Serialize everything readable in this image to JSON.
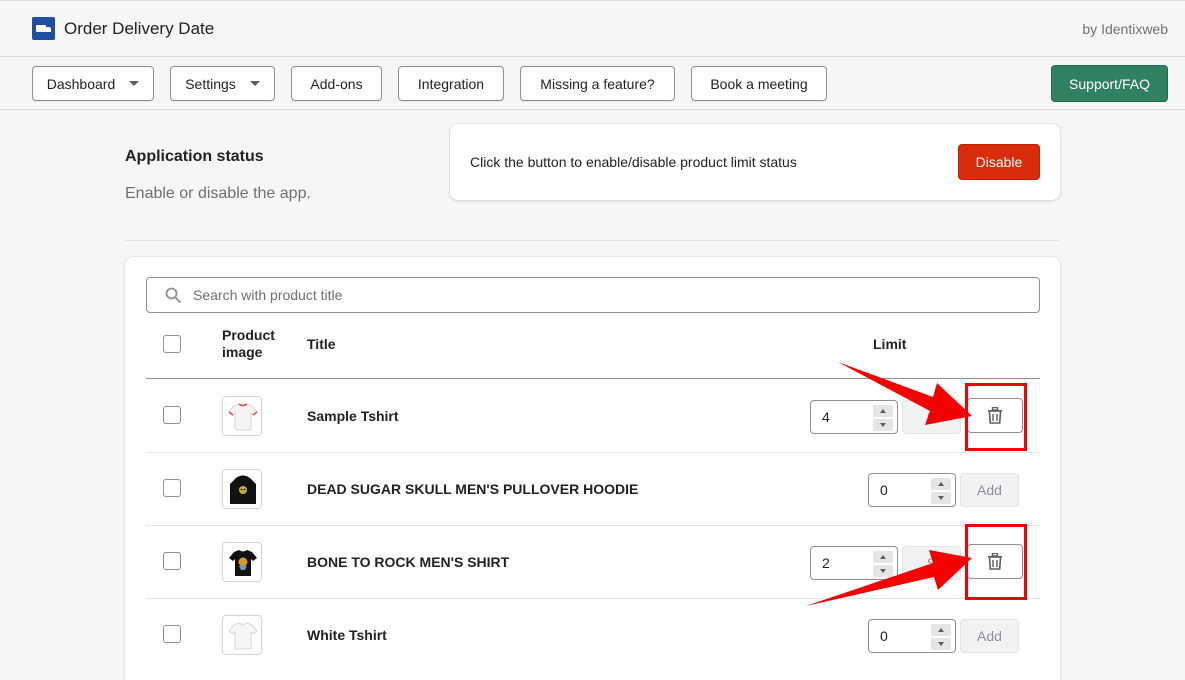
{
  "header": {
    "app_title": "Order Delivery Date",
    "byline": "by Identixweb"
  },
  "nav": {
    "dashboard": "Dashboard",
    "settings": "Settings",
    "addons": "Add-ons",
    "integration": "Integration",
    "missing_feature": "Missing a feature?",
    "book_meeting": "Book a meeting",
    "support": "Support/FAQ"
  },
  "status_section": {
    "title": "Application status",
    "description": "Enable or disable the app.",
    "card_text": "Click the button to enable/disable product limit status",
    "button_label": "Disable",
    "button_color": "#d82c0d"
  },
  "search": {
    "placeholder": "Search with product title"
  },
  "table": {
    "headers": {
      "image": "Product image",
      "title": "Title",
      "limit": "Limit"
    },
    "rows": [
      {
        "title": "Sample Tshirt",
        "limit": "4",
        "action": "S",
        "has_delete": true,
        "image": "white-tshirt-red-trim"
      },
      {
        "title": "DEAD SUGAR SKULL MEN'S PULLOVER HOODIE",
        "limit": "0",
        "action": "Add",
        "has_delete": false,
        "image": "black-hoodie"
      },
      {
        "title": "BONE TO ROCK MEN'S SHIRT",
        "limit": "2",
        "action": "S",
        "has_delete": true,
        "image": "black-tshirt"
      },
      {
        "title": "White Tshirt",
        "limit": "0",
        "action": "Add",
        "has_delete": false,
        "image": "white-tshirt"
      }
    ]
  },
  "annotation_color": "#f40000"
}
